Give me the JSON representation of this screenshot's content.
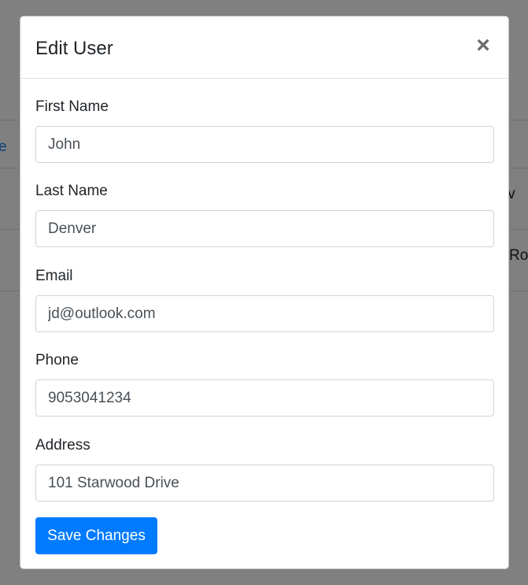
{
  "background": {
    "link_fragment": "e",
    "row1_fragment": "Driv",
    "row2_fragment": "Ro"
  },
  "modal": {
    "title": "Edit User",
    "close_label": "×",
    "fields": [
      {
        "label": "First Name",
        "value": "John"
      },
      {
        "label": "Last Name",
        "value": "Denver"
      },
      {
        "label": "Email",
        "value": "jd@outlook.com"
      },
      {
        "label": "Phone",
        "value": "9053041234"
      },
      {
        "label": "Address",
        "value": "101 Starwood Drive"
      }
    ],
    "save_label": "Save Changes"
  },
  "colors": {
    "overlay": "#808080",
    "primary": "#007bff",
    "input_border": "#ced4da"
  }
}
